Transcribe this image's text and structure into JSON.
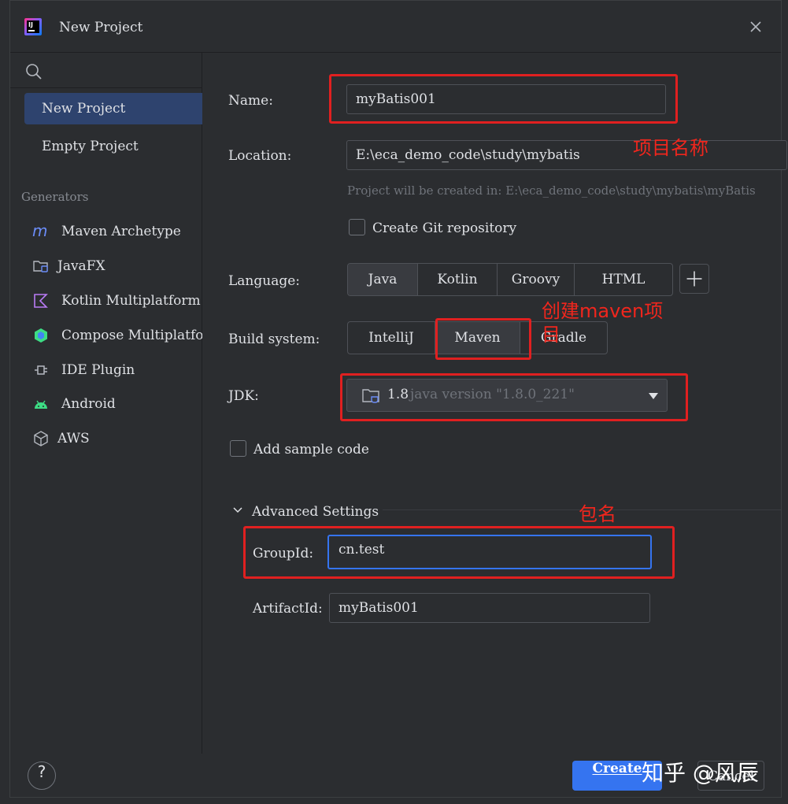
{
  "window": {
    "title": "New Project"
  },
  "sidebar": {
    "items": [
      {
        "label": "New Project",
        "selected": true
      },
      {
        "label": "Empty Project",
        "selected": false
      }
    ],
    "generators_label": "Generators",
    "generators": [
      {
        "label": "Maven Archetype",
        "icon": "maven-icon"
      },
      {
        "label": "JavaFX",
        "icon": "folder-icon"
      },
      {
        "label": "Kotlin Multiplatform",
        "icon": "kotlin-icon"
      },
      {
        "label": "Compose Multiplatform",
        "icon": "compose-icon"
      },
      {
        "label": "IDE Plugin",
        "icon": "plugin-icon"
      },
      {
        "label": "Android",
        "icon": "android-icon"
      },
      {
        "label": "AWS",
        "icon": "aws-icon"
      }
    ]
  },
  "form": {
    "name_label": "Name:",
    "name_value": "myBatis001",
    "location_label": "Location:",
    "location_value": "E:\\eca_demo_code\\study\\mybatis",
    "location_hint": "Project will be created in: E:\\eca_demo_code\\study\\mybatis\\myBatis",
    "git_label": "Create Git repository",
    "git_checked": false,
    "language_label": "Language:",
    "languages": [
      "Java",
      "Kotlin",
      "Groovy",
      "HTML"
    ],
    "language_selected": "Java",
    "build_label": "Build system:",
    "build_systems": [
      "IntelliJ",
      "Maven",
      "Gradle"
    ],
    "build_selected": "Maven",
    "jdk_label": "JDK:",
    "jdk_version": "1.8",
    "jdk_desc": "java version \"1.8.0_221\"",
    "sample_label": "Add sample code",
    "sample_checked": false,
    "advanced_label": "Advanced Settings",
    "groupid_label": "GroupId:",
    "groupid_value": "cn.test",
    "artifactid_label": "ArtifactId:",
    "artifactid_value": "myBatis001"
  },
  "footer": {
    "help": "?",
    "create": "Create",
    "cancel": "Cancel"
  },
  "annotations": {
    "project_name": "项目名称",
    "create_maven": "创建maven项目",
    "package_name": "包名"
  },
  "watermark": "知乎 @风辰",
  "colors": {
    "accent": "#3574f0",
    "selection": "#2e436e",
    "annotation_red": "#e02020"
  }
}
